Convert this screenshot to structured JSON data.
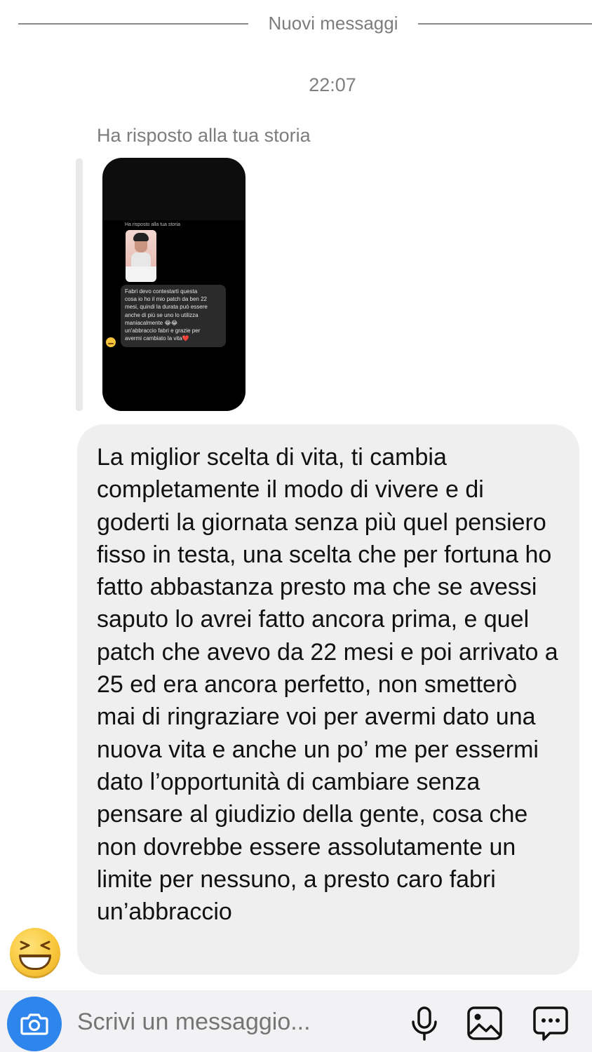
{
  "divider": {
    "label": "Nuovi messaggi"
  },
  "timestamp": "22:07",
  "story_reply": {
    "label": "Ha risposto alla tua storia",
    "thumbnail": {
      "label": "Ha risposto alla tua storia",
      "message_lines": [
        "Fabri devo contestarti questa",
        "cosa io ho il mio patch da ben 22",
        "mesi, quindi la durata può essere",
        "anche di più se uno lo utilizza",
        "maniacalmente 😂😂",
        "un'abbraccio fabri e grazie per",
        "avermi cambiato la vita❤️"
      ]
    }
  },
  "message": {
    "text": "La miglior scelta di vita, ti cambia completamente il modo di vivere e di goderti la giornata senza più quel pensiero fisso in testa, una scelta che per fortuna ho fatto abbastanza presto ma che se avessi saputo lo avrei fatto ancora prima, e quel patch che avevo da 22 mesi e poi arrivato a 25 ed era ancora perfetto, non smetterò mai di ringraziare voi per avermi dato una nuova vita e anche un po’ me per essermi dato l’opportunità di cambiare senza pensare al giudizio della gente, cosa che non dovrebbe essere assolutamente un limite per nessuno, a presto caro fabri un’abbraccio",
    "reaction": "laughing-squint-emoji"
  },
  "composer": {
    "placeholder": "Scrivi un messaggio...",
    "icons": [
      "camera-icon",
      "microphone-icon",
      "gallery-icon",
      "sticker-chat-icon"
    ]
  },
  "colors": {
    "accent": "#2e86ec",
    "bubble": "#efefef",
    "muted_text": "#7d7d7d"
  }
}
